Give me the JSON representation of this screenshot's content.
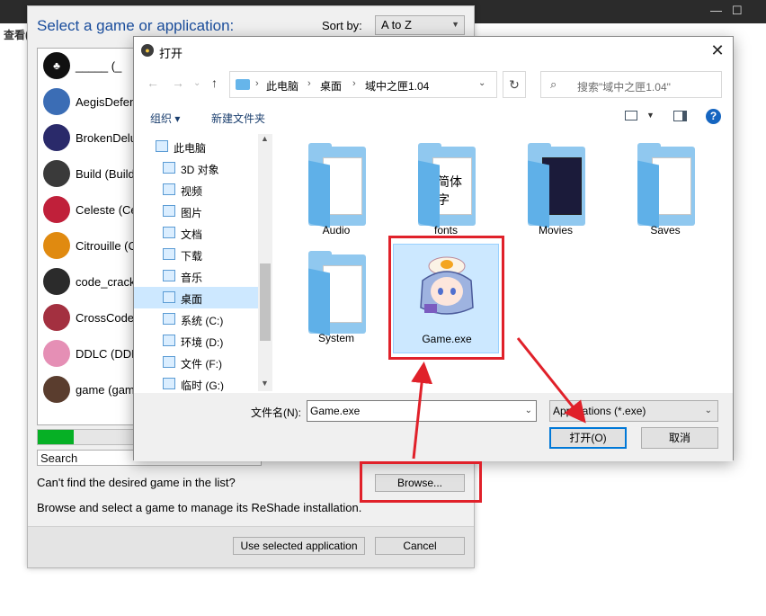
{
  "background": {
    "view_label": "查看("
  },
  "reshade": {
    "title": "Select a game or application:",
    "sort_label": "Sort by:",
    "sort_value": "A to Z",
    "games": [
      {
        "label": "_____ (_",
        "icon": "club-suit-icon",
        "color": "#111111"
      },
      {
        "label": "AegisDefen",
        "icon": "aegis-defenders-icon",
        "color": "#3b6db5"
      },
      {
        "label": "BrokenDelu",
        "icon": "broken-delusion-icon",
        "color": "#2a2a6a"
      },
      {
        "label": "Build (Build",
        "icon": "build-icon",
        "color": "#3a3a3a"
      },
      {
        "label": "Celeste (Ce",
        "icon": "strawberry-icon",
        "color": "#c0203a"
      },
      {
        "label": "Citrouille (C",
        "icon": "pumpkin-icon",
        "color": "#e08a10"
      },
      {
        "label": "code_crack",
        "icon": "code-cracker-icon",
        "color": "#2b2b2b"
      },
      {
        "label": "CrossCode",
        "icon": "crosscode-icon",
        "color": "#a33040"
      },
      {
        "label": "DDLC (DDL",
        "icon": "ddlc-icon",
        "color": "#e58fb5"
      },
      {
        "label": "game (gam",
        "icon": "anime-girl-icon",
        "color": "#5a3d2e"
      }
    ],
    "progress": 0.16,
    "search_value": "Search",
    "cant_find": "Can't find the desired game in the list?",
    "browse_label": "Browse...",
    "description": "Browse and select a game to manage its ReShade installation.",
    "use_selected_label": "Use selected application",
    "cancel_label": "Cancel"
  },
  "dialog": {
    "title": "打开",
    "breadcrumb": [
      "此电脑",
      "桌面",
      "域中之匣1.04"
    ],
    "search_placeholder": "搜索\"域中之匣1.04\"",
    "organize_label": "组织 ▾",
    "new_folder_label": "新建文件夹",
    "nav_items": [
      {
        "label": "此电脑",
        "icon": "pc-icon",
        "top": true
      },
      {
        "label": "3D 对象",
        "icon": "3d-objects-icon"
      },
      {
        "label": "视频",
        "icon": "videos-icon"
      },
      {
        "label": "图片",
        "icon": "pictures-icon"
      },
      {
        "label": "文档",
        "icon": "documents-icon"
      },
      {
        "label": "下载",
        "icon": "downloads-icon"
      },
      {
        "label": "音乐",
        "icon": "music-icon"
      },
      {
        "label": "桌面",
        "icon": "desktop-icon",
        "selected": true
      },
      {
        "label": "系统 (C:)",
        "icon": "drive-icon"
      },
      {
        "label": "环境 (D:)",
        "icon": "drive-icon"
      },
      {
        "label": "文件 (F:)",
        "icon": "drive-icon"
      },
      {
        "label": "临时 (G:)",
        "icon": "drive-icon"
      }
    ],
    "files": [
      {
        "label": "Audio",
        "type": "folder"
      },
      {
        "label": "fonts",
        "type": "folder",
        "doc_text": "简体字"
      },
      {
        "label": "Movies",
        "type": "folder"
      },
      {
        "label": "Saves",
        "type": "folder"
      },
      {
        "label": "System",
        "type": "folder"
      },
      {
        "label": "Game.exe",
        "type": "exe",
        "selected": true
      }
    ],
    "filename_label": "文件名(N):",
    "filename_value": "Game.exe",
    "filetype_value": "Applications (*.exe)",
    "open_label": "打开(O)",
    "cancel_label": "取消"
  },
  "colors": {
    "highlight": "#e0212a",
    "accent": "#0078d7",
    "progress": "#06b025"
  }
}
